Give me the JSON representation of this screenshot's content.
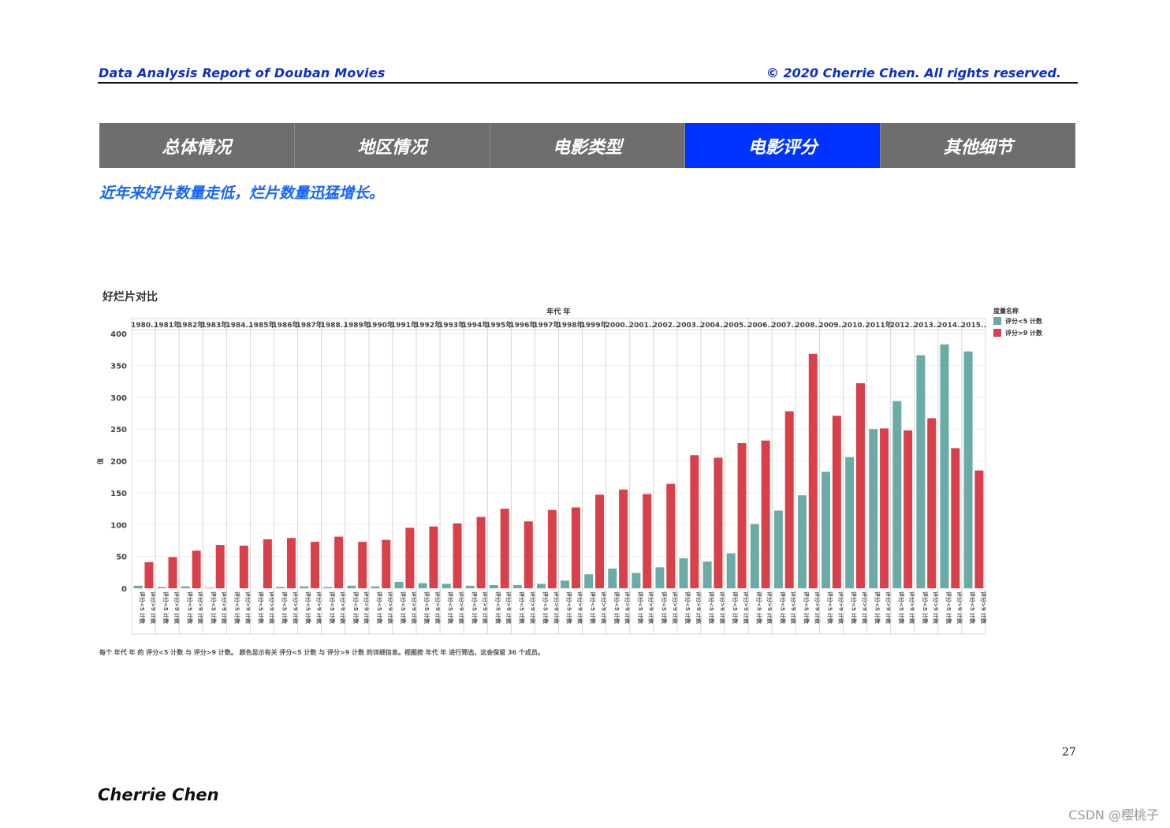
{
  "header": {
    "title": "Data Analysis Report of Douban Movies",
    "copyright": "© 2020 Cherrie Chen. All rights reserved."
  },
  "tabs": [
    {
      "label": "总体情况",
      "active": false
    },
    {
      "label": "地区情况",
      "active": false
    },
    {
      "label": "电影类型",
      "active": false
    },
    {
      "label": "电影评分",
      "active": true
    },
    {
      "label": "其他细节",
      "active": false
    }
  ],
  "headline": "近年来好片数量走低，烂片数量迅猛增长。",
  "footnote": "每个 年代 年 的 评分<5 计数 与 评分>9 计数。 颜色显示有关 评分<5 计数 与 评分>9 计数 的详细信息。视图按 年代 年 进行筛选，这会保留 36 个成员。",
  "page_number": "27",
  "author": "Cherrie Chen",
  "watermark": "CSDN @樱桃子",
  "colors": {
    "low": "#6aaba6",
    "high": "#d8414a",
    "accent": "#0033ff"
  },
  "chart_data": {
    "type": "bar",
    "title": "好烂片对比",
    "top_axis_title": "年代 年",
    "ylabel": "值",
    "ylim": [
      0,
      400
    ],
    "yticks": [
      0,
      50,
      100,
      150,
      200,
      250,
      300,
      350,
      400
    ],
    "legend_title": "度量名称",
    "legend_position": "top-right",
    "categories": [
      "1980..",
      "1981年",
      "1982年",
      "1983年",
      "1984..",
      "1985年",
      "1986年",
      "1987年",
      "1988..",
      "1989年",
      "1990年",
      "1991年",
      "1992年",
      "1993年",
      "1994年",
      "1995年",
      "1996年",
      "1997年",
      "1998年",
      "1999年",
      "2000..",
      "2001..",
      "2002..",
      "2003..",
      "2004..",
      "2005..",
      "2006..",
      "2007..",
      "2008..",
      "2009..",
      "2010..",
      "2011年",
      "2012..",
      "2013..",
      "2014..",
      "2015.."
    ],
    "sub_labels": [
      "评分<5 计数",
      "评分>9 计数"
    ],
    "series": [
      {
        "name": "评分<5 计数",
        "values": [
          4,
          2,
          3,
          1,
          0,
          0,
          2,
          3,
          2,
          4,
          3,
          10,
          8,
          7,
          4,
          5,
          5,
          7,
          12,
          22,
          31,
          24,
          33,
          47,
          42,
          55,
          101,
          122,
          146,
          183,
          206,
          250,
          294,
          366,
          383,
          372
        ]
      },
      {
        "name": "评分>9 计数",
        "values": [
          41,
          49,
          59,
          68,
          67,
          77,
          79,
          73,
          81,
          73,
          76,
          95,
          97,
          102,
          112,
          125,
          105,
          123,
          127,
          147,
          155,
          148,
          164,
          209,
          205,
          228,
          232,
          278,
          368,
          271,
          322,
          251,
          248,
          267,
          220,
          185
        ]
      }
    ]
  }
}
